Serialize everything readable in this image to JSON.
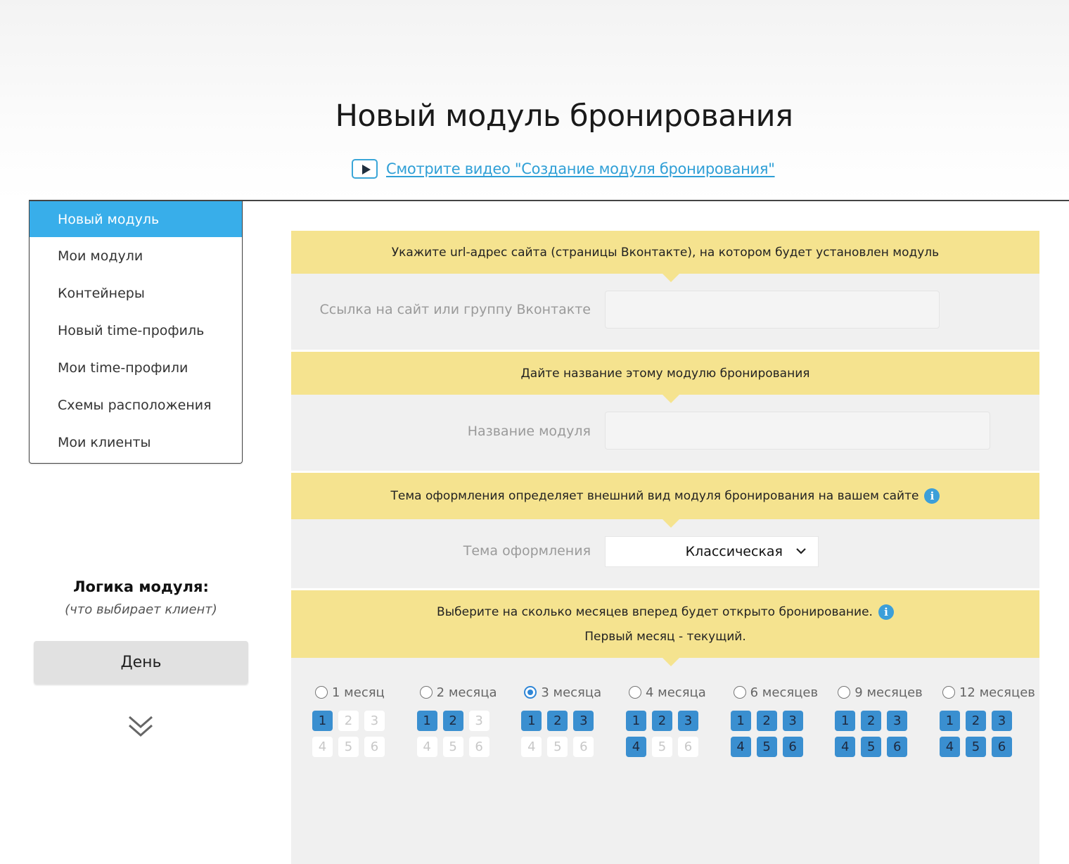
{
  "header": {
    "title": "Новый модуль бронирования",
    "video_link": "Смотрите видео \"Создание модуля бронирования\""
  },
  "sidebar": {
    "items": [
      {
        "label": "Новый модуль",
        "active": true
      },
      {
        "label": "Мои модули"
      },
      {
        "label": "Контейнеры"
      },
      {
        "label": "Новый time-профиль"
      },
      {
        "label": "Мои time-профили"
      },
      {
        "label": "Схемы расположения"
      },
      {
        "label": "Мои клиенты"
      }
    ]
  },
  "logic": {
    "title": "Логика модуля:",
    "subtitle": "(что выбирает клиент)",
    "button": "День"
  },
  "form": {
    "url_section": {
      "heading": "Укажите url-адрес сайта (страницы Вконтакте), на котором будет установлен модуль",
      "label": "Ссылка на сайт или группу Вконтакте",
      "value": ""
    },
    "name_section": {
      "heading": "Дайте название этому модулю бронирования",
      "label": "Название модуля",
      "value": ""
    },
    "theme_section": {
      "heading": "Тема оформления определяет внешний вид модуля бронирования на вашем сайте",
      "label": "Тема оформления",
      "selected": "Классическая",
      "info": "i"
    },
    "months_section": {
      "heading_line1": "Выберите на сколько месяцев вперед будет открыто бронирование.",
      "heading_line2": "Первый месяц - текущий.",
      "info": "i",
      "options": [
        {
          "label": "1 месяц",
          "months": 1
        },
        {
          "label": "2 месяца",
          "months": 2
        },
        {
          "label": "3 месяца",
          "months": 3,
          "selected": true
        },
        {
          "label": "4 месяца",
          "months": 4
        },
        {
          "label": "6 месяцев",
          "months": 6
        },
        {
          "label": "9 месяцев",
          "months": 9
        },
        {
          "label": "12 месяцев",
          "months": 12
        }
      ],
      "grid_labels": [
        [
          "1",
          "2",
          "3",
          "4",
          "5",
          "6"
        ],
        [
          "1",
          "2",
          "3",
          "4",
          "5",
          "6"
        ],
        [
          "1",
          "2",
          "3",
          "4",
          "5",
          "6"
        ],
        [
          "1",
          "2",
          "3",
          "4",
          "5",
          "6"
        ],
        [
          "1",
          "2",
          "3",
          "4",
          "5",
          "6"
        ],
        [
          "1",
          "2",
          "3",
          "4",
          "5",
          "6"
        ],
        [
          "1",
          "2",
          "3",
          "4",
          "5",
          "6"
        ]
      ]
    }
  },
  "colors": {
    "accent": "#38aeea",
    "header_band": "#f5e38f",
    "active_cell": "#3a8fd0",
    "link": "#2f9fd6"
  }
}
